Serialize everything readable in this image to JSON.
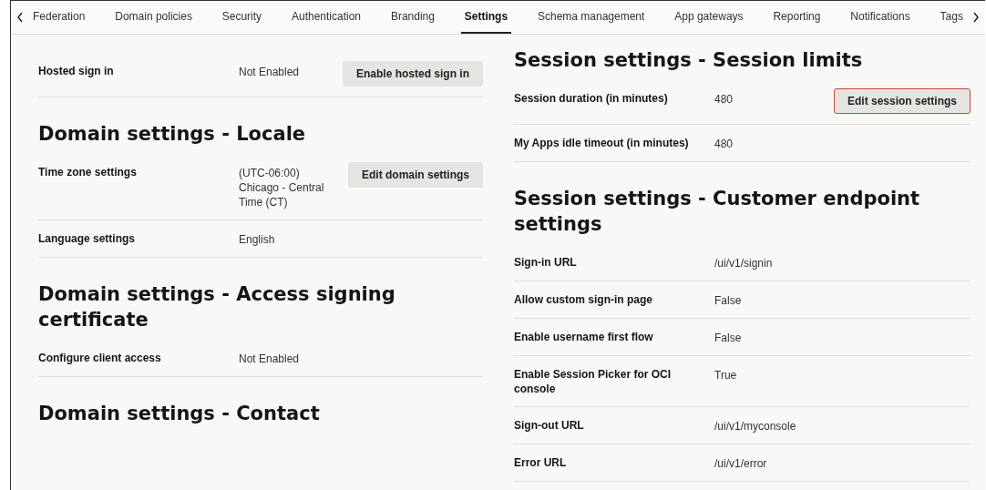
{
  "tabs": [
    {
      "label": "Federation",
      "selected": false
    },
    {
      "label": "Domain policies",
      "selected": false
    },
    {
      "label": "Security",
      "selected": false
    },
    {
      "label": "Authentication",
      "selected": false
    },
    {
      "label": "Branding",
      "selected": false
    },
    {
      "label": "Settings",
      "selected": true
    },
    {
      "label": "Schema management",
      "selected": false
    },
    {
      "label": "App gateways",
      "selected": false
    },
    {
      "label": "Reporting",
      "selected": false
    },
    {
      "label": "Notifications",
      "selected": false
    },
    {
      "label": "Tags",
      "selected": false
    }
  ],
  "left_column": [
    {
      "rows": [
        {
          "label": "Hosted sign in",
          "value": "Not Enabled",
          "button": {
            "label": "Enable hosted sign in",
            "highlighted": false
          }
        }
      ]
    },
    {
      "heading": "Domain settings - Locale",
      "rows": [
        {
          "label": "Time zone settings",
          "value": "(UTC-06:00) Chicago - Central Time (CT)",
          "button": {
            "label": "Edit domain settings",
            "highlighted": false
          }
        },
        {
          "label": "Language settings",
          "value": "English"
        }
      ]
    },
    {
      "heading": "Domain settings - Access signing certificate",
      "rows": [
        {
          "label": "Configure client access",
          "value": "Not Enabled"
        }
      ]
    },
    {
      "heading": "Domain settings - Contact"
    }
  ],
  "right_column": [
    {
      "heading": "Session settings - Session limits",
      "rows": [
        {
          "label": "Session duration (in minutes)",
          "value": "480",
          "button": {
            "label": "Edit session settings",
            "highlighted": true
          }
        },
        {
          "label": "My Apps idle timeout (in minutes)",
          "value": "480"
        }
      ]
    },
    {
      "heading": "Session settings - Customer endpoint settings",
      "rows": [
        {
          "label": "Sign-in URL",
          "value": "/ui/v1/signin"
        },
        {
          "label": "Allow custom sign-in page",
          "value": "False"
        },
        {
          "label": "Enable username first flow",
          "value": "False"
        },
        {
          "label": "Enable Session Picker for OCI console",
          "value": "True"
        },
        {
          "label": "Sign-out URL",
          "value": "/ui/v1/myconsole"
        },
        {
          "label": "Error URL",
          "value": "/ui/v1/error"
        }
      ]
    }
  ]
}
